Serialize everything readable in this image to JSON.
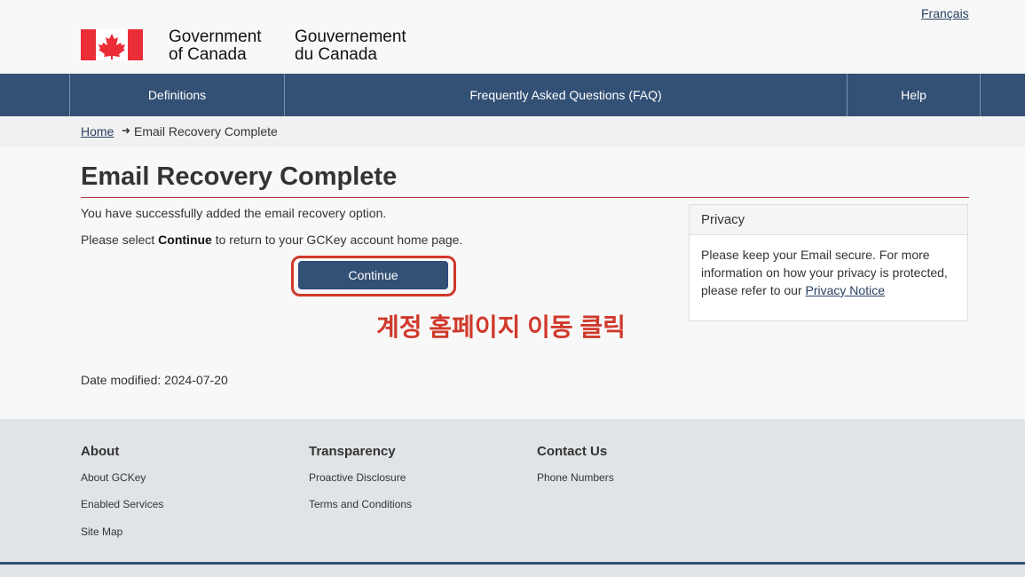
{
  "header": {
    "language_link": "Français",
    "signature_en": [
      "Government",
      "of Canada"
    ],
    "signature_fr": [
      "Gouvernement",
      "du Canada"
    ],
    "flag_color": "#eb2d37"
  },
  "nav": {
    "items": [
      "Definitions",
      "Frequently Asked Questions (FAQ)",
      "Help"
    ]
  },
  "breadcrumb": {
    "home": "Home",
    "separator": "➜",
    "current": "Email Recovery Complete"
  },
  "main": {
    "title": "Email Recovery Complete",
    "message": "You have successfully added the email recovery option.",
    "instruction_pre": "Please select ",
    "instruction_bold": "Continue",
    "instruction_post": " to return to your GCKey account home page.",
    "continue_label": "Continue",
    "annotation": "계정 홈페이지 이동 클릭",
    "date_modified": "Date modified: 2024-07-20"
  },
  "privacy_panel": {
    "heading": "Privacy",
    "body": "Please keep your Email secure. For more information on how your privacy is protected, please refer to our ",
    "link": "Privacy Notice"
  },
  "footer": {
    "columns": [
      {
        "heading": "About",
        "links": [
          "About GCKey",
          "Enabled Services",
          "Site Map"
        ]
      },
      {
        "heading": "Transparency",
        "links": [
          "Proactive Disclosure",
          "Terms and Conditions"
        ]
      },
      {
        "heading": "Contact Us",
        "links": [
          "Phone Numbers"
        ]
      }
    ]
  },
  "colors": {
    "nav_background": "#335075",
    "accent_red": "#d0392b",
    "title_rule": "#af3c43"
  }
}
